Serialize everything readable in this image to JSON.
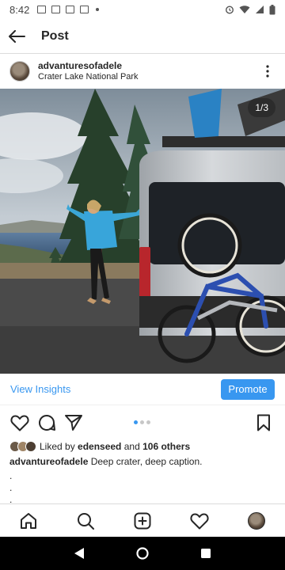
{
  "status_bar": {
    "time": "8:42"
  },
  "header": {
    "title": "Post"
  },
  "post": {
    "username": "advanturesofadele",
    "location": "Crater Lake National Park",
    "counter": "1/3"
  },
  "insights": {
    "view_label": "View Insights",
    "promote_label": "Promote"
  },
  "likes": {
    "prefix": "Liked by ",
    "user": "edenseed",
    "middle": " and ",
    "others": "106 others"
  },
  "caption": {
    "username": "advantureofadele",
    "text": " Deep crater, deep caption."
  },
  "caption_dots": [
    ".",
    ".",
    "."
  ],
  "icons": {
    "back": "arrow-left-icon",
    "more": "more-vertical-icon",
    "like": "heart-icon",
    "comment": "comment-icon",
    "share": "send-icon",
    "save": "bookmark-icon",
    "home": "home-icon",
    "search": "search-icon",
    "add": "add-square-icon",
    "activity": "heart-icon",
    "profile": "avatar"
  },
  "colors": {
    "accent": "#3897f0",
    "text": "#262626"
  }
}
